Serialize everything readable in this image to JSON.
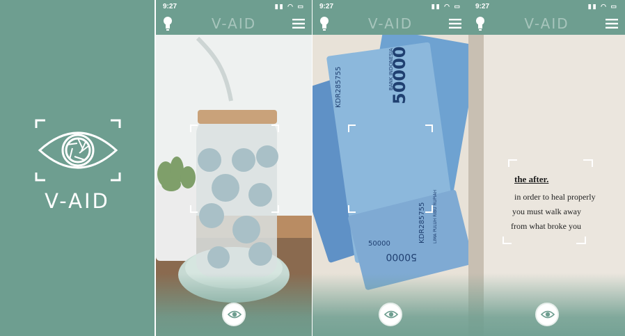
{
  "splash": {
    "brand": "V-AID",
    "background": "#6e9e90",
    "logo_icon": "eye-aperture-icon"
  },
  "screens": [
    {
      "status": {
        "time": "9:27",
        "system_icons": "signal wifi battery"
      },
      "appbar": {
        "title": "V-AID",
        "left_icon": "lightbulb-icon",
        "right_icon": "hamburger-menu-icon"
      },
      "scene": "glass jar with smiley faces and straw",
      "capture_icon": "eye-capture-icon"
    },
    {
      "status": {
        "time": "9:27",
        "system_icons": "signal wifi battery"
      },
      "appbar": {
        "title": "V-AID",
        "left_icon": "lightbulb-icon",
        "right_icon": "hamburger-menu-icon"
      },
      "scene": "banknotes",
      "banknote": {
        "bank": "BANK INDONESIA",
        "value": "50000",
        "serial": "KDR285755",
        "words": "LIMA PULUH RIBU RUPIAH"
      },
      "capture_icon": "eye-capture-icon"
    },
    {
      "status": {
        "time": "9:27",
        "system_icons": "signal wifi battery"
      },
      "appbar": {
        "title": "V-AID",
        "left_icon": "lightbulb-icon",
        "right_icon": "hamburger-menu-icon"
      },
      "scene": "book page",
      "book": {
        "heading": "the after.",
        "lines": [
          "in order to heal properly",
          "you must walk away",
          "from what broke you"
        ]
      },
      "capture_icon": "eye-capture-icon"
    }
  ],
  "colors": {
    "accent": "#6e9e90",
    "title_tint": "#a7c5bc"
  }
}
